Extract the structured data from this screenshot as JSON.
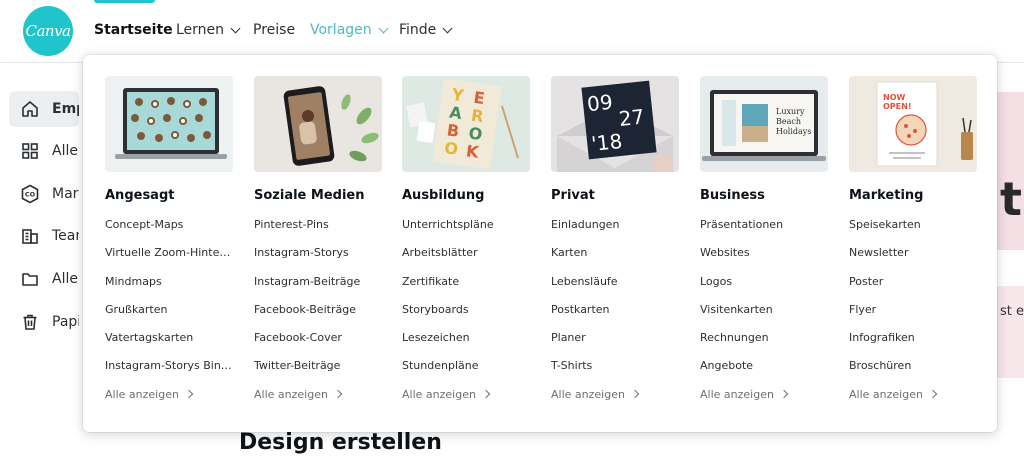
{
  "brand": {
    "logo_text": "Canva",
    "accent": "#20c4cb",
    "open_menu_color": "#4fb8c6"
  },
  "nav": {
    "home": "Startseite",
    "learn": "Lernen",
    "pricing": "Preise",
    "templates": "Vorlagen",
    "find": "Finde"
  },
  "sidebar": {
    "items": [
      {
        "label": "Empf",
        "icon": "home-icon"
      },
      {
        "label": "Alle d",
        "icon": "grid-icon"
      },
      {
        "label": "Mark",
        "icon": "brand-kit-icon"
      },
      {
        "label": "Team",
        "icon": "team-icon"
      },
      {
        "label": "Alle d",
        "icon": "folder-icon"
      },
      {
        "label": "Papie",
        "icon": "trash-icon"
      }
    ]
  },
  "background": {
    "big_text": "ta",
    "small_text": "st es,",
    "design_title": "Design erstellen"
  },
  "dropdown": {
    "show_all_label": "Alle anzeigen",
    "columns": [
      {
        "title": "Angesagt",
        "thumb": "laptop-puppies",
        "links": [
          "Concept-Maps",
          "Virtuelle Zoom-Hinte…",
          "Mindmaps",
          "Grußkarten",
          "Vatertagskarten",
          "Instagram-Storys Bin…"
        ]
      },
      {
        "title": "Soziale Medien",
        "thumb": "phone-story",
        "links": [
          "Pinterest-Pins",
          "Instagram-Storys",
          "Instagram-Beiträge",
          "Facebook-Beiträge",
          "Facebook-Cover",
          "Twitter-Beiträge"
        ]
      },
      {
        "title": "Ausbildung",
        "thumb": "yearbook",
        "thumb_text": [
          "Y",
          "E",
          "A",
          "R",
          "B",
          "O",
          "O",
          "K"
        ],
        "links": [
          "Unterrichtspläne",
          "Arbeitsblätter",
          "Zertifikate",
          "Storyboards",
          "Lesezeichen",
          "Stundenpläne"
        ]
      },
      {
        "title": "Privat",
        "thumb": "date-card",
        "thumb_text": [
          "09",
          "27",
          "'18"
        ],
        "links": [
          "Einladungen",
          "Karten",
          "Lebensläufe",
          "Postkarten",
          "Planer",
          "T-Shirts"
        ]
      },
      {
        "title": "Business",
        "thumb": "laptop-presentation",
        "thumb_text": [
          "Luxury",
          "Beach",
          "Holidays"
        ],
        "links": [
          "Präsentationen",
          "Websites",
          "Logos",
          "Visitenkarten",
          "Rechnungen",
          "Angebote"
        ]
      },
      {
        "title": "Marketing",
        "thumb": "poster-pizza",
        "thumb_text": [
          "NOW",
          "OPEN!"
        ],
        "links": [
          "Speisekarten",
          "Newsletter",
          "Poster",
          "Flyer",
          "Infografiken",
          "Broschüren"
        ]
      }
    ]
  }
}
